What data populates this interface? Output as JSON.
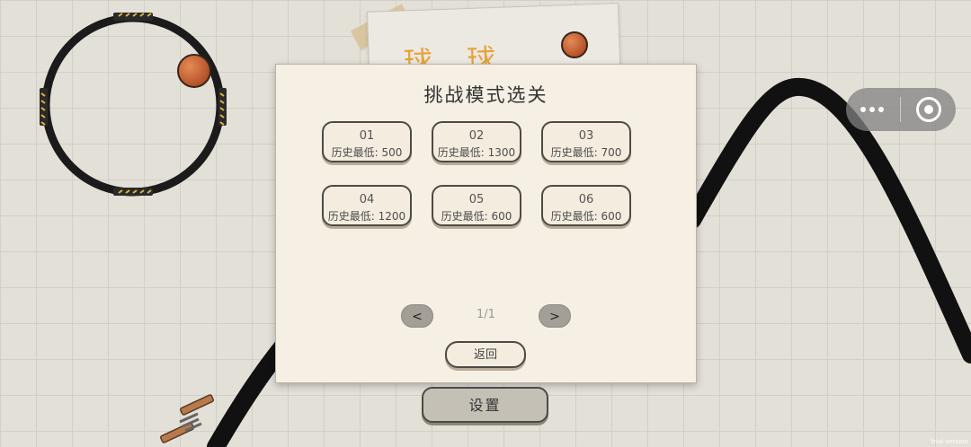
{
  "background": {
    "paper_card_text": "球 球"
  },
  "modal": {
    "title": "挑战模式选关",
    "levels": [
      {
        "number": "01",
        "best": "历史最低: 500"
      },
      {
        "number": "02",
        "best": "历史最低: 1300"
      },
      {
        "number": "03",
        "best": "历史最低: 700"
      },
      {
        "number": "04",
        "best": "历史最低: 1200"
      },
      {
        "number": "05",
        "best": "历史最低: 600"
      },
      {
        "number": "06",
        "best": "历史最低: 600"
      }
    ],
    "pagination": {
      "prev_label": "<",
      "page_text": "1/1",
      "next_label": ">"
    },
    "back_label": "返回"
  },
  "settings_label": "设置",
  "capsule": {
    "more_icon": "more-dots-icon",
    "close_icon": "target-circle-icon"
  },
  "watermark": "trial version",
  "colors": {
    "ball": "#c86a3c",
    "track": "#111111",
    "paper_title": "#e6a33c",
    "hazard": "#e3b341"
  }
}
